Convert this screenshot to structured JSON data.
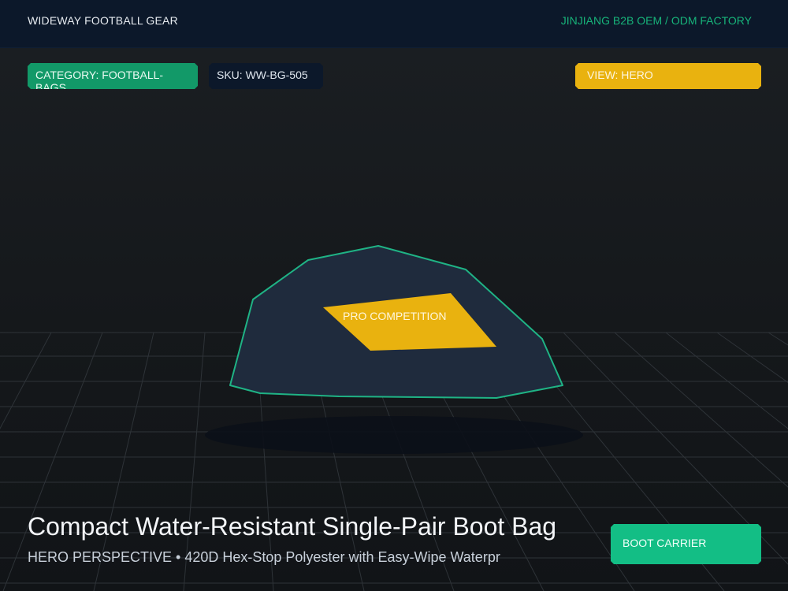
{
  "header": {
    "brand": "WIDEWAY FOOTBALL GEAR",
    "factory": "JINJIANG B2B OEM / ODM FACTORY"
  },
  "chips": {
    "category": "CATEGORY: FOOTBALL-BAGS",
    "sku": "SKU: WW-BG-505",
    "view": "VIEW: HERO"
  },
  "product": {
    "badge": "PRO COMPETITION",
    "title": "Compact Water-Resistant Single-Pair Boot Bag",
    "subtitle": "HERO PERSPECTIVE • 420D Hex-Stop Polyester with Easy-Wipe Waterpr",
    "cta_label": "BOOT CARRIER"
  },
  "colors": {
    "header_bg": "#0c182a",
    "accent_green": "#13be85",
    "category_chip": "#129968",
    "accent_yellow": "#e9b20f",
    "bag_body": "#1f2b3d",
    "bag_outline": "#1fb385"
  }
}
